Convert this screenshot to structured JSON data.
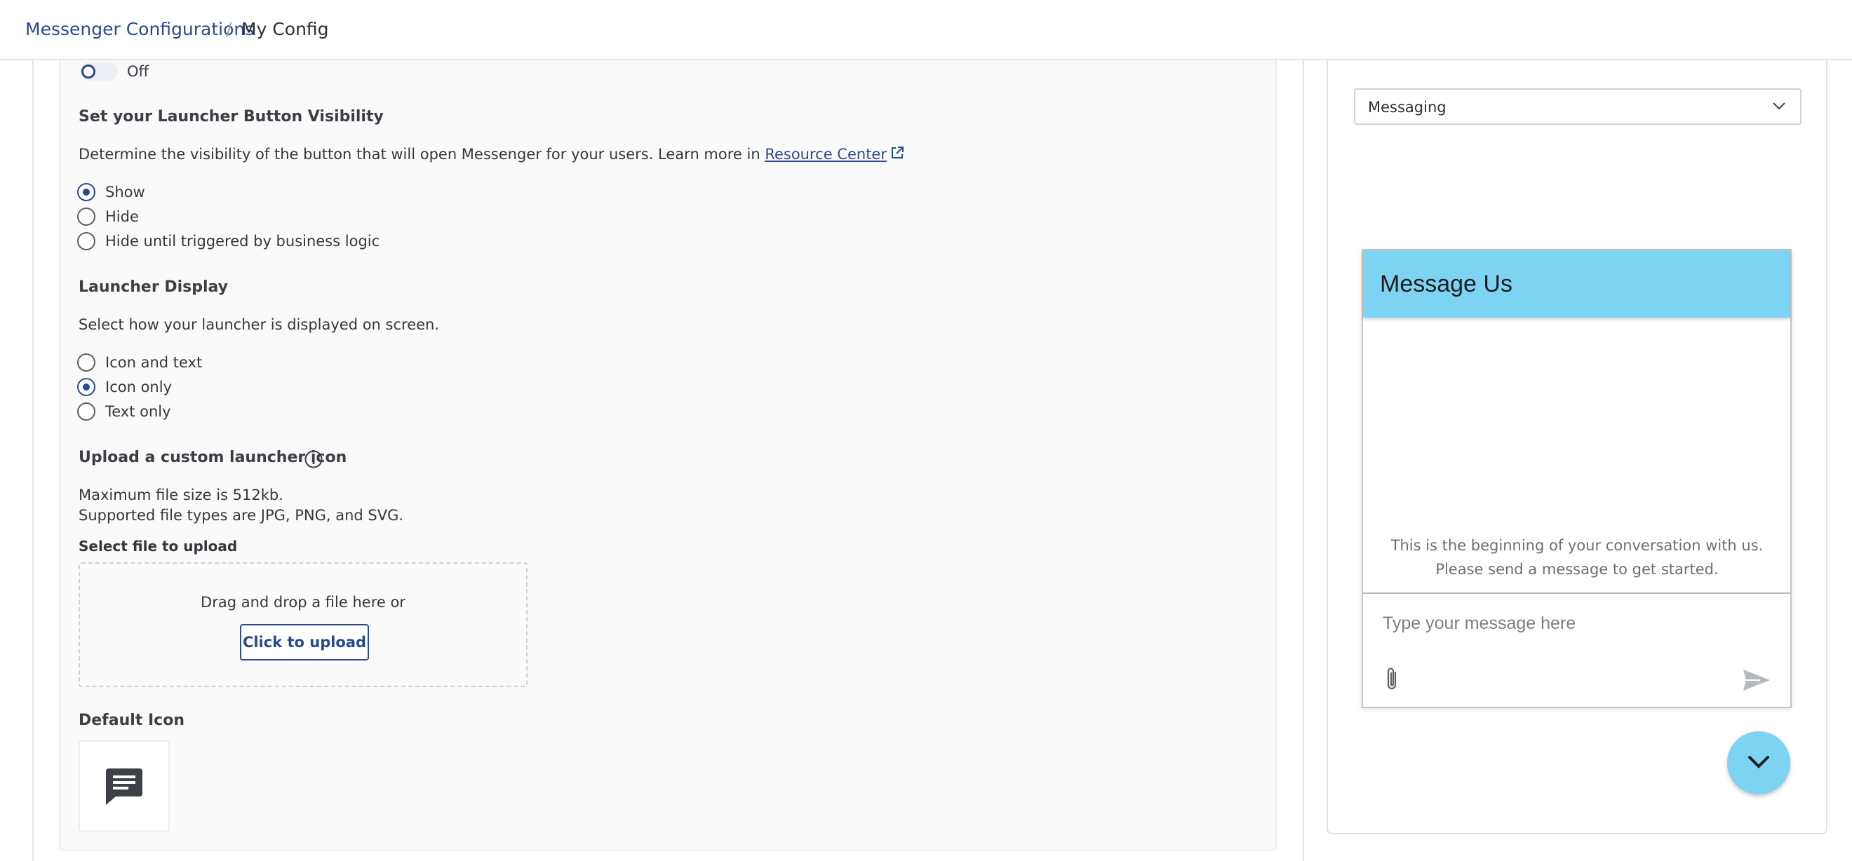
{
  "breadcrumb": {
    "parent": "Messenger Configurations",
    "separator": "/",
    "current": "My Config"
  },
  "toggle": {
    "label": "Off",
    "state": "off"
  },
  "launcher_visibility": {
    "title": "Set your Launcher Button Visibility",
    "description": "Determine the visibility of the button that will open Messenger for your users. Learn more in",
    "link_text": "Resource Center",
    "options": [
      {
        "label": "Show",
        "checked": true
      },
      {
        "label": "Hide",
        "checked": false
      },
      {
        "label": "Hide until triggered by business logic",
        "checked": false
      }
    ]
  },
  "launcher_display": {
    "title": "Launcher Display",
    "description": "Select how your launcher is displayed on screen.",
    "options": [
      {
        "label": "Icon and text",
        "checked": false
      },
      {
        "label": "Icon only",
        "checked": true
      },
      {
        "label": "Text only",
        "checked": false
      }
    ]
  },
  "upload": {
    "title": "Upload a custom launcher icon",
    "max_size": "Maximum file size is 512kb.",
    "file_types": "Supported file types are JPG, PNG, and SVG.",
    "select_label": "Select file to upload",
    "drop_text": "Drag and drop a file here or",
    "button_label": "Click to upload"
  },
  "default_icon": {
    "title": "Default Icon",
    "icon": "chat-bubble-icon"
  },
  "preview": {
    "select_value": "Messaging",
    "chat": {
      "title": "Message Us",
      "intro": "This is the beginning of your conversation with us. Please send a message to get started.",
      "input_placeholder": "Type your message here",
      "attach_icon": "paperclip-icon",
      "send_icon": "send-icon"
    },
    "fab_icon": "chevron-down-icon"
  },
  "colors": {
    "accent": "#2a4a8f",
    "chat_header": "#7dd3f2",
    "fab": "#7dd3f2"
  }
}
